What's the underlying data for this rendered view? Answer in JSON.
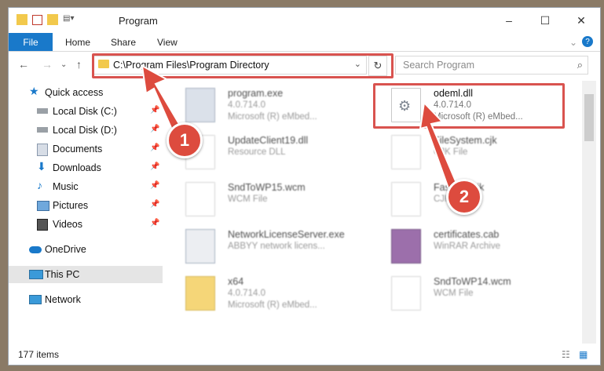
{
  "window": {
    "title": "Program",
    "controls": {
      "minimize": "–",
      "maximize": "☐",
      "close": "✕"
    },
    "help": "?"
  },
  "ribbon": {
    "tabs": [
      "File",
      "Home",
      "Share",
      "View"
    ]
  },
  "address": {
    "path": "C:\\Program Files\\Program Directory",
    "search_placeholder": "Search Program"
  },
  "nav_pane": {
    "items": [
      {
        "label": "Quick access",
        "icon": "star-icon"
      },
      {
        "label": "Local Disk (C:)",
        "icon": "drive-icon",
        "pinned": true
      },
      {
        "label": "Local Disk (D:)",
        "icon": "drive-icon",
        "pinned": true
      },
      {
        "label": "Documents",
        "icon": "documents-icon",
        "pinned": true
      },
      {
        "label": "Downloads",
        "icon": "download-icon",
        "pinned": true
      },
      {
        "label": "Music",
        "icon": "music-icon",
        "pinned": true
      },
      {
        "label": "Pictures",
        "icon": "pictures-icon",
        "pinned": true
      },
      {
        "label": "Videos",
        "icon": "videos-icon",
        "pinned": true
      },
      {
        "label": "OneDrive",
        "icon": "cloud-icon"
      },
      {
        "label": "This PC",
        "icon": "computer-icon",
        "selected": true
      },
      {
        "label": "Network",
        "icon": "network-icon"
      }
    ]
  },
  "files": [
    {
      "name": "program.exe",
      "line1": "4.0.714.0",
      "line2": "Microsoft (R) eMbed...",
      "icon": "exe-icon",
      "blurred": true
    },
    {
      "name": "odeml.dll",
      "line1": "4.0.714.0",
      "line2": "Microsoft (R) eMbed...",
      "icon": "dll-gear-icon",
      "blurred": false
    },
    {
      "name": "UpdateClient19.dll",
      "line1": "Resource DLL",
      "line2": "",
      "icon": "dll-gear-icon",
      "blurred": true
    },
    {
      "name": "FileSystem.cjk",
      "line1": "CJK File",
      "line2": "",
      "icon": "file-icon",
      "blurred": true
    },
    {
      "name": "SndToWP15.wcm",
      "line1": "WCM File",
      "line2": "",
      "icon": "file-icon",
      "blurred": true
    },
    {
      "name": "FastNav.cjk",
      "line1": "CJK File",
      "line2": "",
      "icon": "file-icon",
      "blurred": true
    },
    {
      "name": "NetworkLicenseServer.exe",
      "line1": "ABBYY network licens...",
      "line2": "",
      "icon": "exe-icon",
      "blurred": true
    },
    {
      "name": "certificates.cab",
      "line1": "WinRAR Archive",
      "line2": "",
      "icon": "archive-icon",
      "blurred": true
    },
    {
      "name": "x64",
      "line1": "4.0.714.0",
      "line2": "Microsoft (R) eMbed...",
      "icon": "folder-icon",
      "blurred": true
    },
    {
      "name": "SndToWP14.wcm",
      "line1": "WCM File",
      "line2": "",
      "icon": "file-icon",
      "blurred": true
    }
  ],
  "status": {
    "item_count": "177 items"
  },
  "callouts": [
    "1",
    "2"
  ],
  "colors": {
    "accent": "#1979ca",
    "highlight": "#d9534f",
    "selected_bg": "#e5e5e5"
  }
}
